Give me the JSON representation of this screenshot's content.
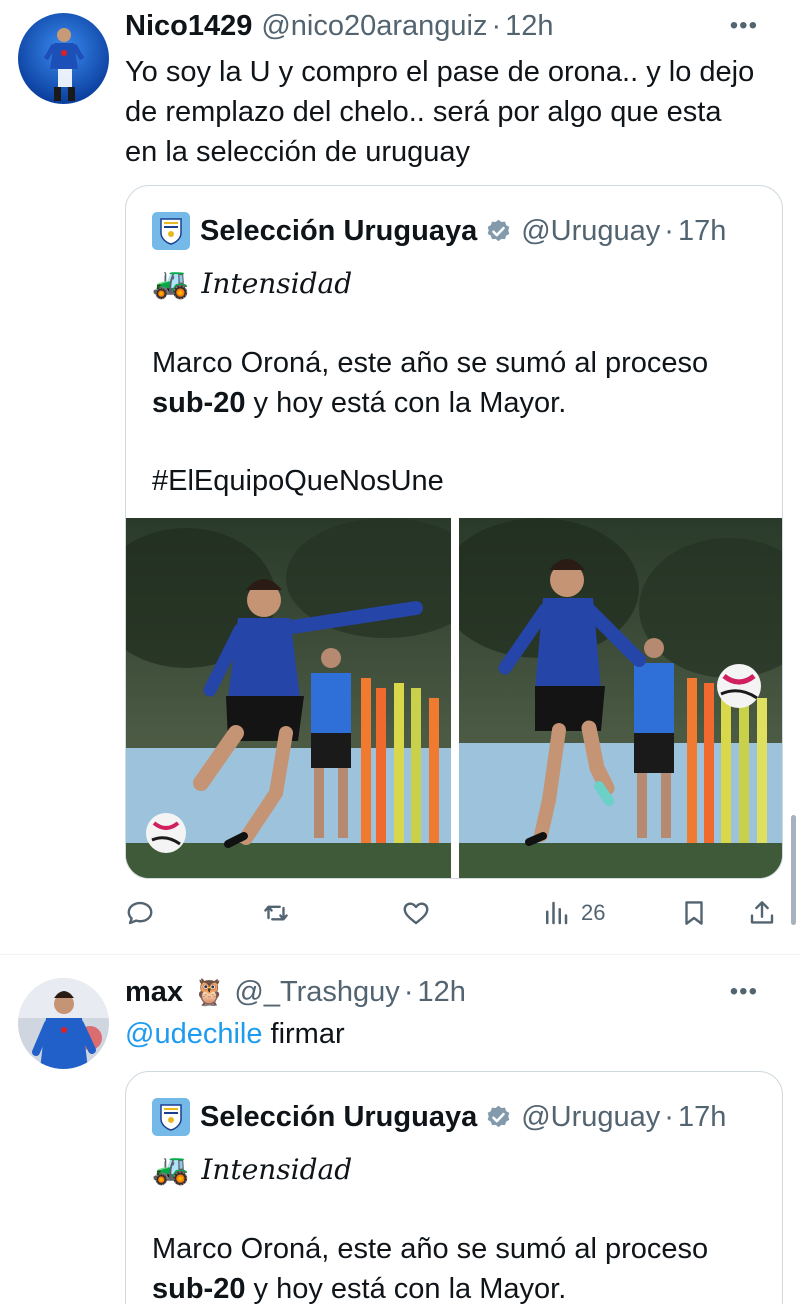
{
  "tweets": [
    {
      "user": {
        "name": "Nico1429",
        "handle": "@nico20aranguiz",
        "time": "12h"
      },
      "text": "Yo soy la U y compro el pase de orona.. y lo dejo de remplazo del chelo.. será por algo que esta en la selección de uruguay",
      "text_lines": [
        "Yo soy la U y compro el pase de orona.. y lo dejo",
        "de remplazo del chelo.. será por algo que esta",
        "en la selección de uruguay"
      ],
      "quote": {
        "name": "Selección Uruguaya",
        "handle": "@Uruguay",
        "time": "17h",
        "subtitle": "Intensidad",
        "line1": "Marco Oroná, este año se sumó al proceso",
        "line2_bold": "sub-20",
        "line2_rest": " y hoy está con la Mayor.",
        "hashtag": "#ElEquipoQueNosUne"
      },
      "actions": {
        "views": "26"
      }
    },
    {
      "user": {
        "name": "max",
        "handle": "@_Trashguy",
        "time": "12h"
      },
      "text_mention": "@udechile",
      "text_rest": " firmar",
      "quote": {
        "name": "Selección Uruguaya",
        "handle": "@Uruguay",
        "time": "17h",
        "subtitle": "Intensidad",
        "line1": "Marco Oroná, este año se sumó al proceso",
        "line2_bold": "sub-20",
        "line2_rest": " y hoy está con la Mayor."
      }
    }
  ],
  "icons": {
    "more": "more-icon",
    "verified": "verified-badge-icon",
    "reply": "reply-icon",
    "retweet": "retweet-icon",
    "like": "like-icon",
    "views": "views-icon",
    "bookmark": "bookmark-icon",
    "share": "share-icon"
  },
  "colors": {
    "link": "#1d9bf0",
    "secondary_text": "#536471",
    "border": "#cfd9de"
  }
}
